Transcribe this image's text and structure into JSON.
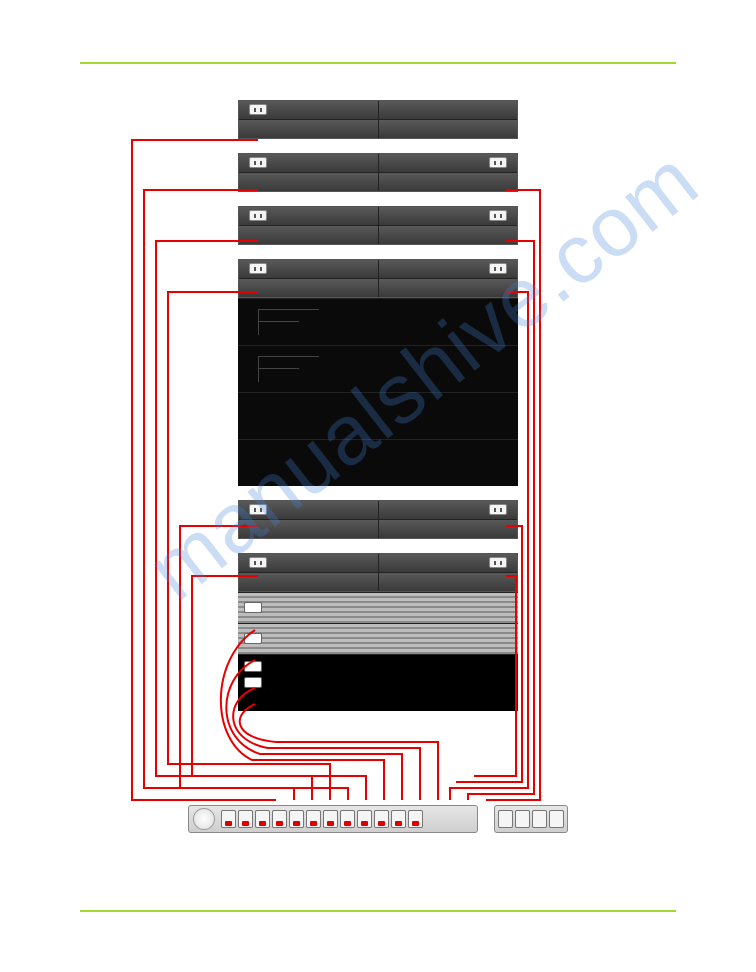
{
  "watermark": "manualshive.com",
  "diagram": {
    "rack_units_top": [
      {
        "type": "psu_pair",
        "left_port": true,
        "right_port": false
      },
      {
        "type": "psu_pair",
        "left_port": false,
        "right_port": false
      },
      {
        "type": "air_gap"
      },
      {
        "type": "psu_pair",
        "left_port": true,
        "right_port": true
      },
      {
        "type": "psu_pair",
        "left_port": false,
        "right_port": false
      },
      {
        "type": "air_gap"
      },
      {
        "type": "psu_pair",
        "left_port": true,
        "right_port": true
      },
      {
        "type": "psu_pair",
        "left_port": false,
        "right_port": false
      },
      {
        "type": "air_gap"
      },
      {
        "type": "psu_pair",
        "left_port": true,
        "right_port": true
      },
      {
        "type": "psu_pair",
        "left_port": false,
        "right_port": false
      }
    ],
    "dark_blocks": 4,
    "rack_units_bottom": [
      {
        "type": "psu_pair",
        "left_port": true,
        "right_port": true
      },
      {
        "type": "psu_pair",
        "left_port": false,
        "right_port": false
      },
      {
        "type": "air_gap"
      },
      {
        "type": "psu_pair",
        "left_port": true,
        "right_port": true
      },
      {
        "type": "psu_pair",
        "left_port": false,
        "right_port": false
      }
    ],
    "banded_units": 2,
    "solid_black_ports": 2,
    "pdu": {
      "sockets_used": 12,
      "sockets_ext": 4
    }
  }
}
